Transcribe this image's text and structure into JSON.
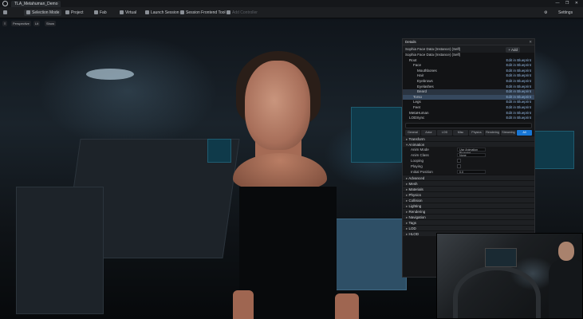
{
  "titlebar": {
    "tab_label": "TLA_Metahuman_Demo",
    "window_controls": "— ❐ ✕"
  },
  "toolbar": {
    "save_icon": "save-icon",
    "mode_label": "Selection Mode",
    "platforms_label": "Project",
    "content_label": "Fab",
    "blueprint_label": "Virtual",
    "sequencer_label": "Launch Session",
    "session_label": "Session Frontend Tool",
    "add_label": "Add Controller",
    "settings_label": "Settings"
  },
  "viewport": {
    "perspective_label": "Perspective",
    "lit_label": "Lit",
    "show_label": "Show"
  },
  "details": {
    "title": "Details",
    "actor_name": "Sophia Face Data (Instance) (Self)",
    "add_label": "+ Add",
    "tree": [
      {
        "name": "Sophia Face Data (Instance) (Self)",
        "editable": "",
        "indent": 0
      },
      {
        "name": "Root",
        "editable": "Edit in Blueprint",
        "indent": 1
      },
      {
        "name": "Face",
        "editable": "Edit in Blueprint",
        "indent": 2
      },
      {
        "name": "Mouthbones",
        "editable": "Edit in Blueprint",
        "indent": 3
      },
      {
        "name": "Hair",
        "editable": "Edit in Blueprint",
        "indent": 3
      },
      {
        "name": "Eyebrows",
        "editable": "Edit in Blueprint",
        "indent": 3
      },
      {
        "name": "Eyelashes",
        "editable": "Edit in Blueprint",
        "indent": 3
      },
      {
        "name": "Beard",
        "editable": "Edit in Blueprint",
        "indent": 3
      },
      {
        "name": "Torso",
        "editable": "Edit in Blueprint",
        "indent": 2
      },
      {
        "name": "Legs",
        "editable": "Edit in Blueprint",
        "indent": 2
      },
      {
        "name": "Feet",
        "editable": "Edit in Blueprint",
        "indent": 2
      },
      {
        "name": "MetaHuman",
        "editable": "Edit in Blueprint",
        "indent": 1
      },
      {
        "name": "LODSync",
        "editable": "Edit in Blueprint",
        "indent": 1
      }
    ],
    "filter_tabs": [
      "General",
      "Actor",
      "LOD",
      "Misc",
      "Physics",
      "Rendering",
      "Streaming",
      "All"
    ],
    "categories": [
      "Transform",
      "Animation"
    ],
    "props": [
      {
        "label": "Anim Mode",
        "value": "Use Animation Blueprint"
      },
      {
        "label": "Anim Class",
        "value": "None"
      },
      {
        "label": "Looping",
        "value": ""
      },
      {
        "label": "Playing",
        "value": ""
      },
      {
        "label": "Initial Position",
        "value": "0.0"
      }
    ],
    "more_categories": [
      "Advanced",
      "Mesh",
      "Materials",
      "Physics",
      "Collision",
      "Lighting",
      "Rendering",
      "Navigation",
      "Tags",
      "LOD",
      "HLOD"
    ]
  },
  "webcam": {
    "label": "presenter webcam"
  }
}
